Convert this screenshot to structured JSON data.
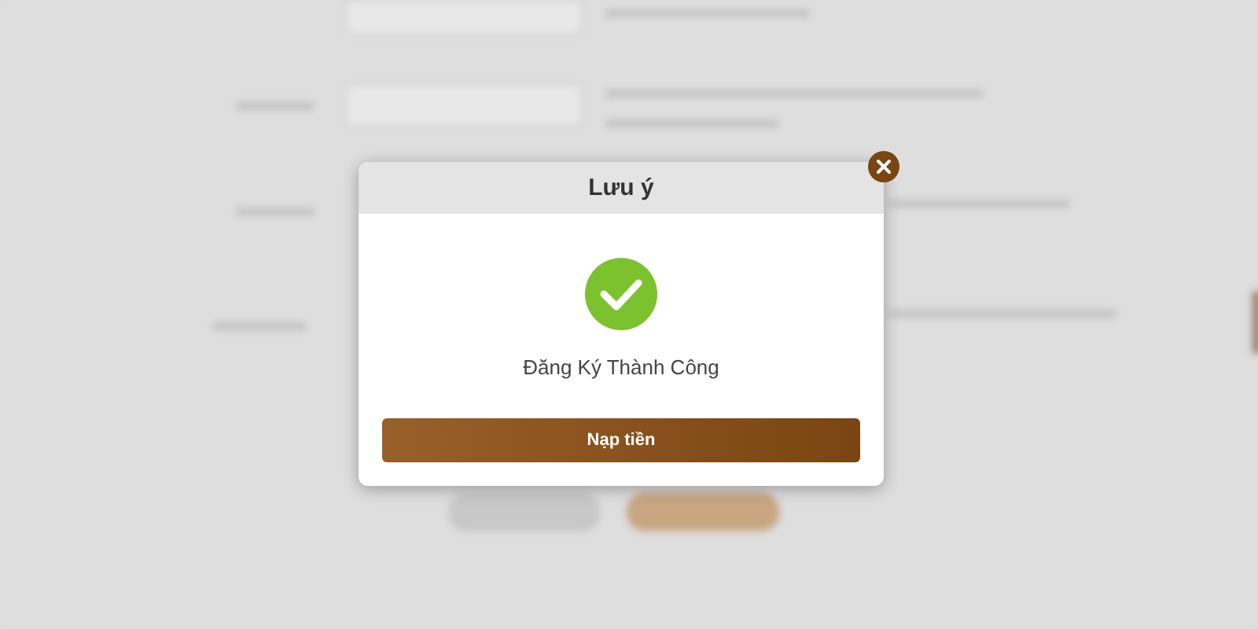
{
  "dialog": {
    "title": "Lưu ý",
    "message": "Đăng Ký Thành Công",
    "button": "Nạp tiền"
  }
}
